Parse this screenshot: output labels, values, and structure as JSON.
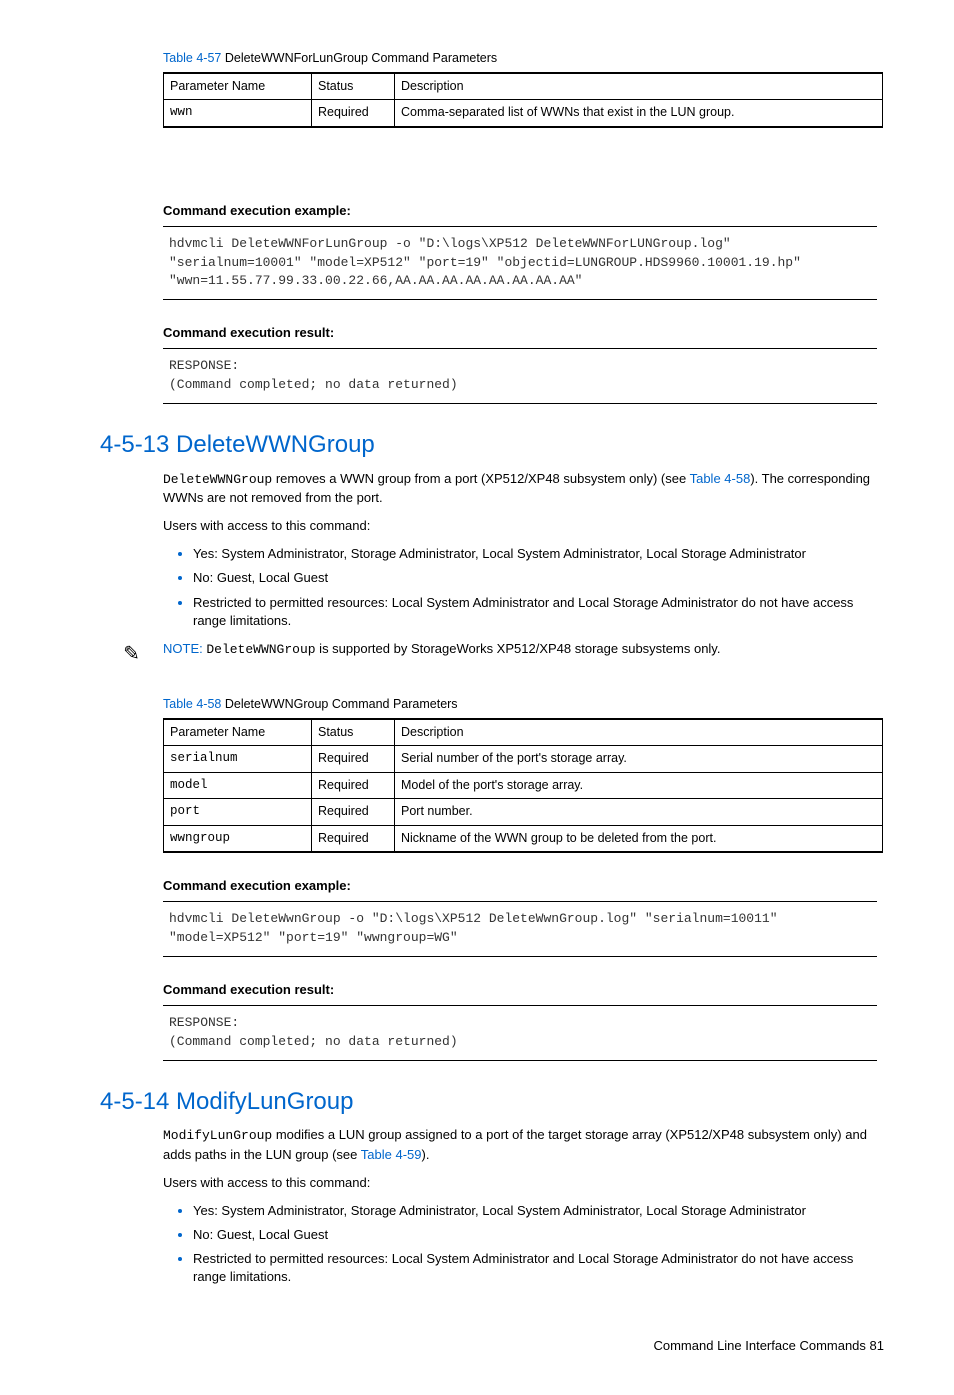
{
  "table57": {
    "caption_ref": "Table 4-57",
    "caption_rest": "  DeleteWWNForLunGroup Command Parameters",
    "headers": {
      "c1": "Parameter Name",
      "c2": "Status",
      "c3": "Description"
    },
    "row": {
      "name": "wwn",
      "status": "Required",
      "desc": "Comma-separated list of WWNs that exist in the LUN group."
    }
  },
  "exec_example_label": "Command execution example:",
  "exec_result_label": "Command execution result:",
  "code1": "hdvmcli DeleteWWNForLunGroup -o \"D:\\logs\\XP512 DeleteWWNForLUNGroup.log\" \"serialnum=10001\" \"model=XP512\" \"port=19\" \"objectid=LUNGROUP.HDS9960.10001.19.hp\" \"wwn=11.55.77.99.33.00.22.66,AA.AA.AA.AA.AA.AA.AA.AA\"",
  "code2": "RESPONSE:\n(Command completed; no data returned)",
  "h_4513": "4-5-13 DeleteWWNGroup",
  "p4513_1a": "DeleteWWNGroup",
  "p4513_1b": " removes a WWN group from a port (XP512/XP48 subsystem only) (see ",
  "p4513_1c": "Table 4-58",
  "p4513_1d": "). The corresponding WWNs are not removed from the port.",
  "p_users": "Users with access to this command:",
  "bullets": {
    "b1": "Yes: System Administrator, Storage Administrator, Local System Administrator, Local Storage Administrator",
    "b2": "No: Guest, Local Guest",
    "b3": "Restricted to permitted resources: Local System Administrator and Local Storage Administrator do not have access range limitations."
  },
  "note_icon": "✎",
  "note_label": "NOTE:  ",
  "note_mono": "DeleteWWNGroup",
  "note_rest": " is supported by StorageWorks XP512/XP48 storage subsystems only.",
  "table58": {
    "caption_ref": "Table 4-58",
    "caption_rest": "  DeleteWWNGroup Command Parameters",
    "headers": {
      "c1": "Parameter Name",
      "c2": "Status",
      "c3": "Description"
    },
    "r1": {
      "name": "serialnum",
      "status": "Required",
      "desc": "Serial number of the port's storage array."
    },
    "r2": {
      "name": "model",
      "status": "Required",
      "desc": "Model of the port's storage array."
    },
    "r3": {
      "name": "port",
      "status": "Required",
      "desc": "Port number."
    },
    "r4": {
      "name": "wwngroup",
      "status": "Required",
      "desc": "Nickname of the WWN group to be deleted from the port."
    }
  },
  "code3": "hdvmcli DeleteWwnGroup -o \"D:\\logs\\XP512 DeleteWwnGroup.log\" \"serialnum=10011\" \"model=XP512\" \"port=19\" \"wwngroup=WG\"",
  "code4": "RESPONSE:\n(Command completed; no data returned)",
  "h_4514": "4-5-14 ModifyLunGroup",
  "p4514_1a": "ModifyLunGroup",
  "p4514_1b": " modifies a LUN group assigned to a port of the target storage array (XP512/XP48 subsystem only) and adds paths in the LUN group (see ",
  "p4514_1c": "Table 4-59",
  "p4514_1d": ").",
  "footer": "Command Line Interface Commands   81"
}
